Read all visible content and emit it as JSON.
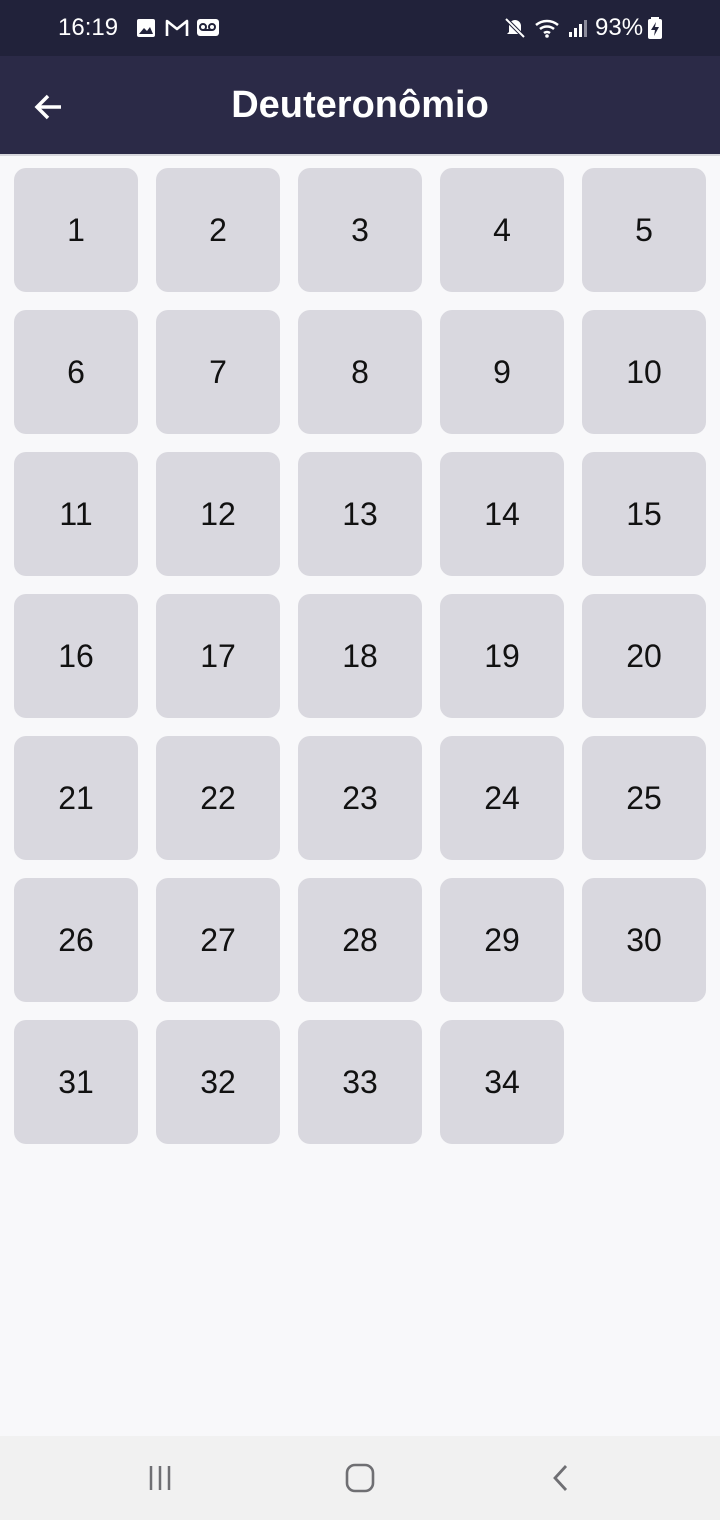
{
  "status_bar": {
    "time": "16:19",
    "battery_percent": "93%",
    "icons": [
      "gallery-icon",
      "gmail-icon",
      "voicemail-icon",
      "mute-icon",
      "wifi-icon",
      "signal-icon",
      "battery-charging-icon"
    ]
  },
  "header": {
    "title": "Deuteronômio",
    "back_icon": "arrow-left-icon"
  },
  "chapters": [
    "1",
    "2",
    "3",
    "4",
    "5",
    "6",
    "7",
    "8",
    "9",
    "10",
    "11",
    "12",
    "13",
    "14",
    "15",
    "16",
    "17",
    "18",
    "19",
    "20",
    "21",
    "22",
    "23",
    "24",
    "25",
    "26",
    "27",
    "28",
    "29",
    "30",
    "31",
    "32",
    "33",
    "34"
  ],
  "nav_bar": {
    "icons": [
      "recent-apps-icon",
      "home-icon",
      "back-icon"
    ]
  },
  "colors": {
    "status_bar_bg": "#21223a",
    "app_bar_bg": "#2b2a47",
    "tile_bg": "#d9d8df",
    "page_bg": "#f8f8fa"
  }
}
